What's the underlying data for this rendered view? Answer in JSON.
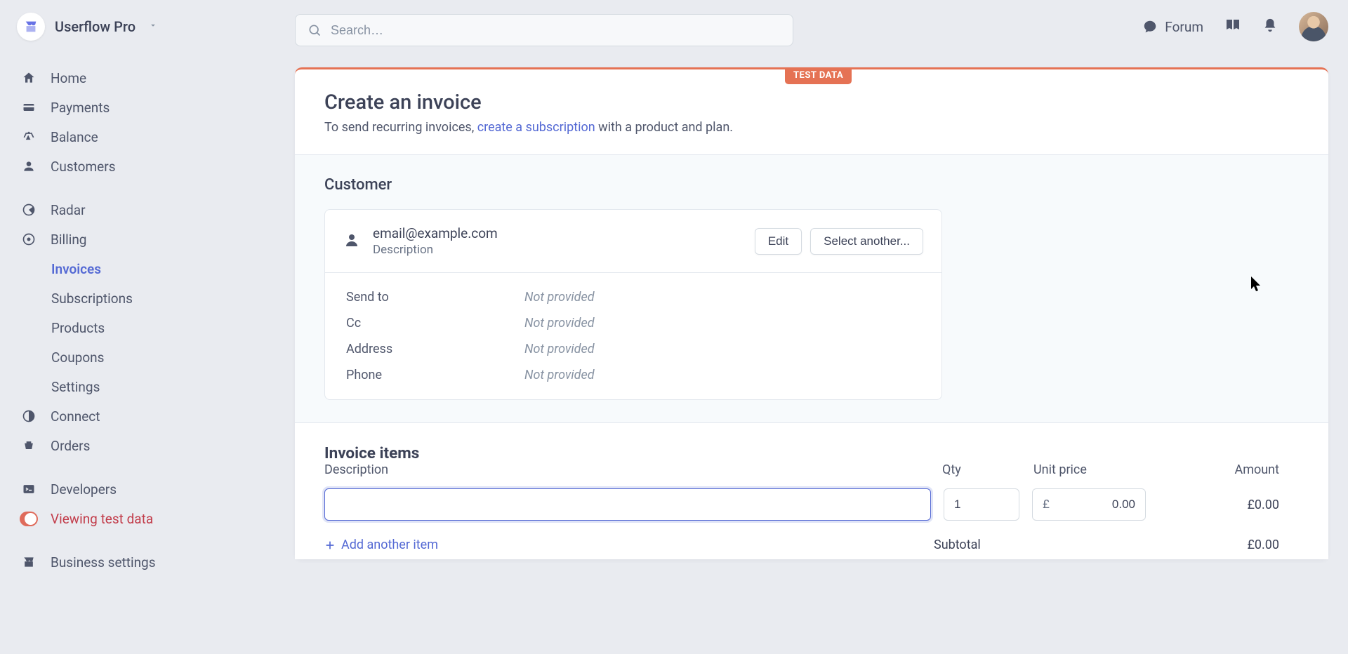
{
  "brand": {
    "name": "Userflow Pro"
  },
  "search": {
    "placeholder": "Search…"
  },
  "topnav": {
    "forum": "Forum"
  },
  "sidebar": {
    "items": [
      {
        "label": "Home",
        "icon": "home"
      },
      {
        "label": "Payments",
        "icon": "payments"
      },
      {
        "label": "Balance",
        "icon": "balance"
      },
      {
        "label": "Customers",
        "icon": "customers"
      }
    ],
    "group2": [
      {
        "label": "Radar",
        "icon": "radar"
      },
      {
        "label": "Billing",
        "icon": "billing",
        "children": [
          {
            "label": "Invoices",
            "active": true
          },
          {
            "label": "Subscriptions"
          },
          {
            "label": "Products"
          },
          {
            "label": "Coupons"
          },
          {
            "label": "Settings"
          }
        ]
      },
      {
        "label": "Connect",
        "icon": "connect"
      },
      {
        "label": "Orders",
        "icon": "orders"
      }
    ],
    "developers": "Developers",
    "test_data": "Viewing test data",
    "business": "Business settings"
  },
  "badge": "TEST DATA",
  "header": {
    "title": "Create an invoice",
    "sub_pre": "To send recurring invoices, ",
    "sub_link": "create a subscription",
    "sub_post": " with a product and plan."
  },
  "customer": {
    "heading": "Customer",
    "email": "email@example.com",
    "desc": "Description",
    "edit": "Edit",
    "select": "Select another...",
    "fields": [
      {
        "label": "Send to",
        "value": "Not provided"
      },
      {
        "label": "Cc",
        "value": "Not provided"
      },
      {
        "label": "Address",
        "value": "Not provided"
      },
      {
        "label": "Phone",
        "value": "Not provided"
      }
    ]
  },
  "items": {
    "heading": "Invoice items",
    "cols": {
      "desc": "Description",
      "qty": "Qty",
      "price": "Unit price",
      "amount": "Amount"
    },
    "row": {
      "desc": "",
      "qty": "1",
      "currency": "£",
      "price": "0.00",
      "amount": "£0.00"
    },
    "add": "Add another item",
    "subtotal_label": "Subtotal",
    "subtotal_value": "£0.00"
  }
}
